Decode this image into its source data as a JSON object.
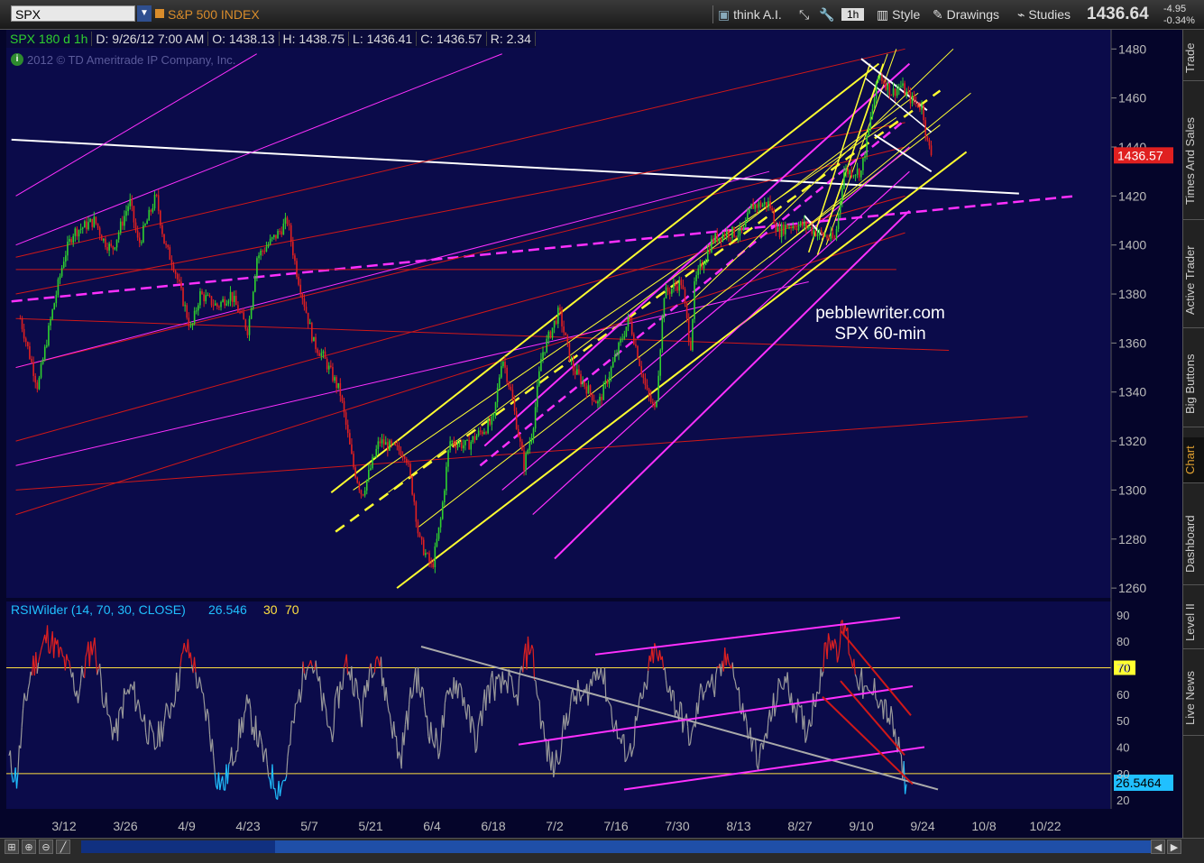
{
  "topbar": {
    "symbol": "SPX",
    "symbol_name": "S&P 500 INDEX",
    "think_ai": "think A.I.",
    "timeframe": "1h",
    "style": "Style",
    "drawings": "Drawings",
    "studies": "Studies",
    "last_price": "1436.64",
    "change": "-4.95",
    "change_pct": "-0.34%"
  },
  "header": {
    "chart_label": "SPX 180 d 1h",
    "date": "D: 9/26/12 7:00 AM",
    "open": "O: 1438.13",
    "high": "H: 1438.75",
    "low": "L: 1436.41",
    "close": "C: 1436.57",
    "range": "R: 2.34",
    "copyright": "2012 © TD Ameritrade IP Company, Inc."
  },
  "sidetabs": [
    "Trade",
    "Times And Sales",
    "Active Trader",
    "Big Buttons",
    "Chart",
    "Dashboard",
    "Level II",
    "Live News"
  ],
  "active_tab": "Chart",
  "colors": {
    "chart_bg": "#0b0b4a",
    "up": "#2fd02f",
    "down": "#e02020",
    "yellow": "#ffff30",
    "magenta": "#ff30ff",
    "red_line": "#d01818",
    "white": "#ffffff",
    "rsi_gray": "#9a9a9a",
    "rsi_ob": "#e02020",
    "rsi_os": "#20c0ff"
  },
  "chart_data": [
    {
      "type": "candlestick",
      "symbol": "SPX",
      "interval": "1h",
      "annotation": [
        "pebblewriter.com",
        "SPX 60-min"
      ],
      "price_label": "1436.57",
      "ylim": [
        1256,
        1486
      ],
      "yticks": [
        1260,
        1280,
        1300,
        1320,
        1340,
        1360,
        1380,
        1400,
        1420,
        1440,
        1460,
        1480
      ],
      "xticks": [
        "3/12",
        "3/26",
        "4/9",
        "4/23",
        "5/7",
        "5/21",
        "6/4",
        "6/18",
        "7/2",
        "7/16",
        "7/30",
        "8/13",
        "8/27",
        "9/10",
        "9/24",
        "10/8",
        "10/22"
      ],
      "price_path": [
        [
          "3/2",
          1370
        ],
        [
          "3/6",
          1342
        ],
        [
          "3/9",
          1370
        ],
        [
          "3/12",
          1395
        ],
        [
          "3/14",
          1405
        ],
        [
          "3/19",
          1410
        ],
        [
          "3/21",
          1402
        ],
        [
          "3/23",
          1398
        ],
        [
          "3/27",
          1418
        ],
        [
          "3/29",
          1400
        ],
        [
          "4/2",
          1420
        ],
        [
          "4/4",
          1400
        ],
        [
          "4/6",
          1392
        ],
        [
          "4/10",
          1365
        ],
        [
          "4/12",
          1380
        ],
        [
          "4/16",
          1375
        ],
        [
          "4/19",
          1380
        ],
        [
          "4/23",
          1365
        ],
        [
          "4/25",
          1395
        ],
        [
          "4/30",
          1405
        ],
        [
          "5/2",
          1410
        ],
        [
          "5/4",
          1390
        ],
        [
          "5/8",
          1360
        ],
        [
          "5/10",
          1355
        ],
        [
          "5/14",
          1340
        ],
        [
          "5/17",
          1310
        ],
        [
          "5/19",
          1298
        ],
        [
          "5/23",
          1320
        ],
        [
          "5/25",
          1318
        ],
        [
          "5/29",
          1315
        ],
        [
          "5/31",
          1295
        ],
        [
          "6/1",
          1280
        ],
        [
          "6/4",
          1268
        ],
        [
          "6/6",
          1288
        ],
        [
          "6/8",
          1320
        ],
        [
          "6/12",
          1318
        ],
        [
          "6/14",
          1322
        ],
        [
          "6/18",
          1328
        ],
        [
          "6/20",
          1355
        ],
        [
          "6/22",
          1340
        ],
        [
          "6/25",
          1310
        ],
        [
          "6/27",
          1325
        ],
        [
          "6/29",
          1355
        ],
        [
          "7/3",
          1373
        ],
        [
          "7/6",
          1350
        ],
        [
          "7/10",
          1340
        ],
        [
          "7/12",
          1335
        ],
        [
          "7/16",
          1355
        ],
        [
          "7/19",
          1370
        ],
        [
          "7/23",
          1340
        ],
        [
          "7/25",
          1332
        ],
        [
          "7/27",
          1380
        ],
        [
          "7/31",
          1385
        ],
        [
          "8/2",
          1358
        ],
        [
          "8/3",
          1385
        ],
        [
          "8/7",
          1402
        ],
        [
          "8/10",
          1405
        ],
        [
          "8/14",
          1405
        ],
        [
          "8/16",
          1416
        ],
        [
          "8/20",
          1417
        ],
        [
          "8/22",
          1405
        ],
        [
          "8/24",
          1408
        ],
        [
          "8/28",
          1408
        ],
        [
          "8/31",
          1405
        ],
        [
          "9/4",
          1402
        ],
        [
          "9/6",
          1430
        ],
        [
          "9/10",
          1430
        ],
        [
          "9/13",
          1460
        ],
        [
          "9/14",
          1470
        ],
        [
          "9/17",
          1462
        ],
        [
          "9/19",
          1465
        ],
        [
          "9/21",
          1460
        ],
        [
          "9/24",
          1456
        ],
        [
          "9/25",
          1442
        ],
        [
          "9/26",
          1437
        ]
      ]
    },
    {
      "type": "line",
      "title": "RSIWilder (14, 70, 30, CLOSE)",
      "value": "26.546",
      "current_label": "26.5464",
      "oversold": "30",
      "overbought": "70",
      "ylim": [
        17,
        93
      ],
      "yticks": [
        20,
        30,
        40,
        50,
        60,
        70,
        80,
        90
      ],
      "series": [
        {
          "values": [
            35,
            28,
            55,
            70,
            75,
            82,
            78,
            73,
            68,
            60,
            72,
            80,
            65,
            50,
            45,
            58,
            62,
            55,
            47,
            40,
            48,
            55,
            65,
            78,
            72,
            60,
            50,
            30,
            25,
            35,
            45,
            55,
            48,
            38,
            30,
            25,
            28,
            48,
            62,
            76,
            68,
            55,
            45,
            60,
            72,
            65,
            52,
            70,
            76,
            62,
            48,
            35,
            52,
            68,
            58,
            45,
            40,
            55,
            65,
            62,
            50,
            42,
            58,
            64,
            62,
            66,
            56,
            70,
            80,
            58,
            40,
            32,
            42,
            55,
            60,
            58,
            65,
            72,
            60,
            48,
            40,
            38,
            52,
            62,
            76,
            72,
            64,
            55,
            50,
            42,
            58,
            66,
            62,
            70,
            76,
            60,
            50,
            40,
            36,
            48,
            58,
            66,
            60,
            52,
            46,
            58,
            70,
            82,
            78,
            86,
            72,
            65,
            58,
            62,
            55,
            50,
            38,
            26
          ]
        }
      ]
    }
  ]
}
